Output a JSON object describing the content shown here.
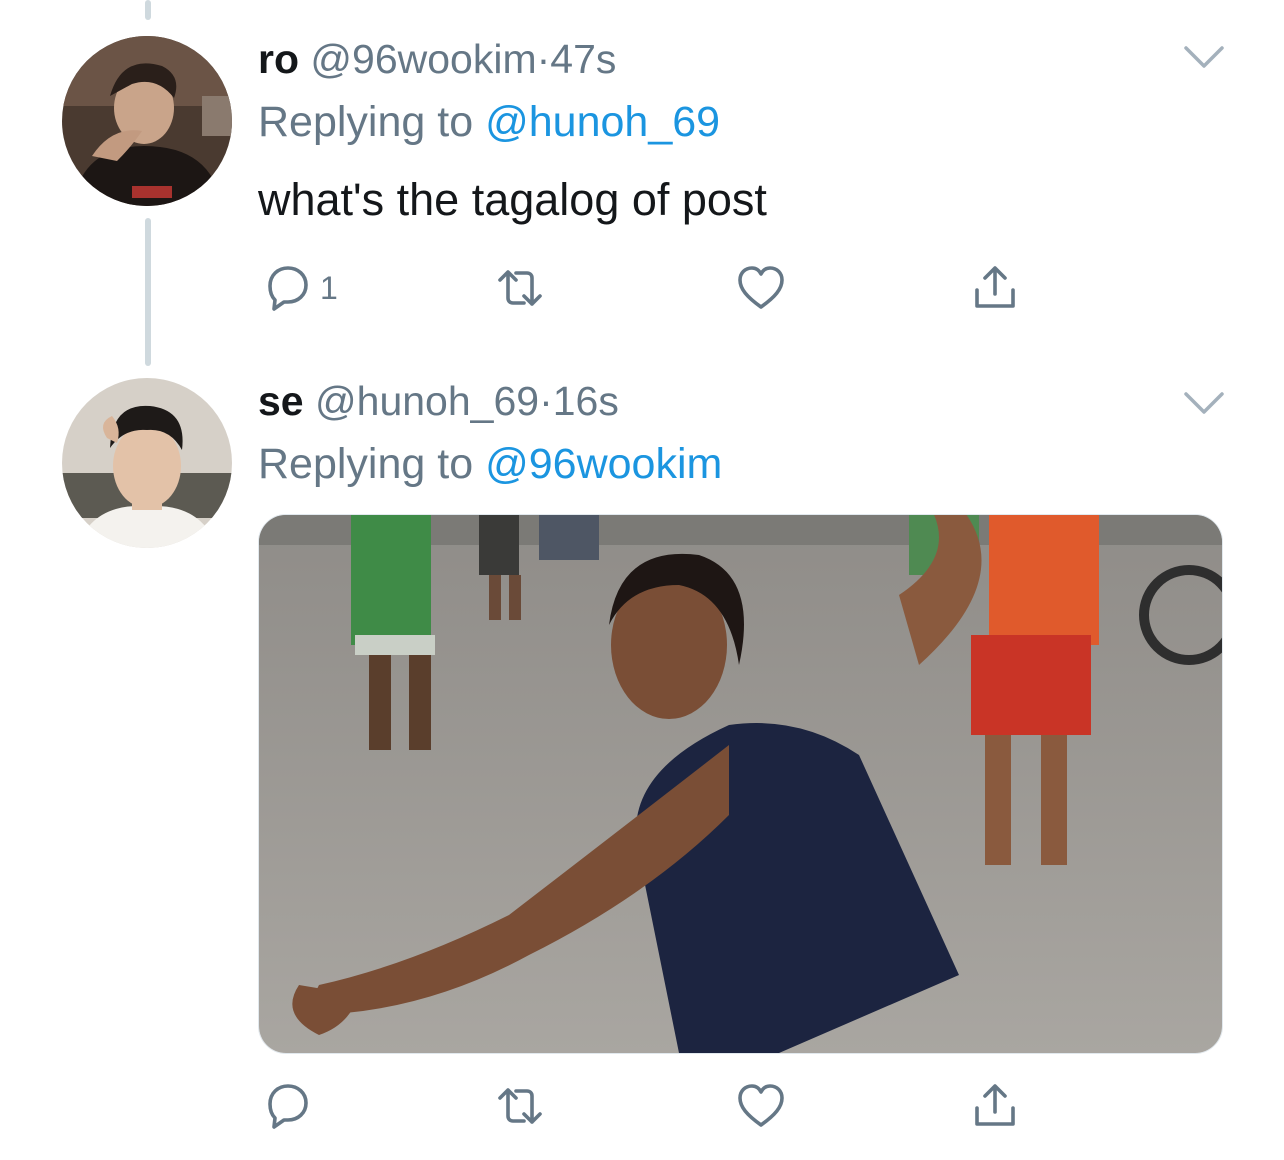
{
  "tweets": [
    {
      "name": "ro",
      "handle": "@96wookim",
      "separator": "·",
      "time": "47s",
      "replying_prefix": "Replying to",
      "replying_to": "@hunoh_69",
      "text": "what's the tagalog of post",
      "reply_count": "1",
      "avatar_icon": "avatar-photo",
      "avatar_bg": "#3a2e28"
    },
    {
      "name": "se",
      "handle": "@hunoh_69",
      "separator": "·",
      "time": "16s",
      "replying_prefix": "Replying to",
      "replying_to": "@96wookim",
      "avatar_icon": "avatar-photo",
      "avatar_bg": "#cfc8bf"
    }
  ],
  "colors": {
    "link": "#1b95e0",
    "muted": "#657786",
    "thread_line": "#cfd9de"
  },
  "icons": [
    "reply-icon",
    "retweet-icon",
    "like-icon",
    "share-icon",
    "chevron-down-icon"
  ]
}
